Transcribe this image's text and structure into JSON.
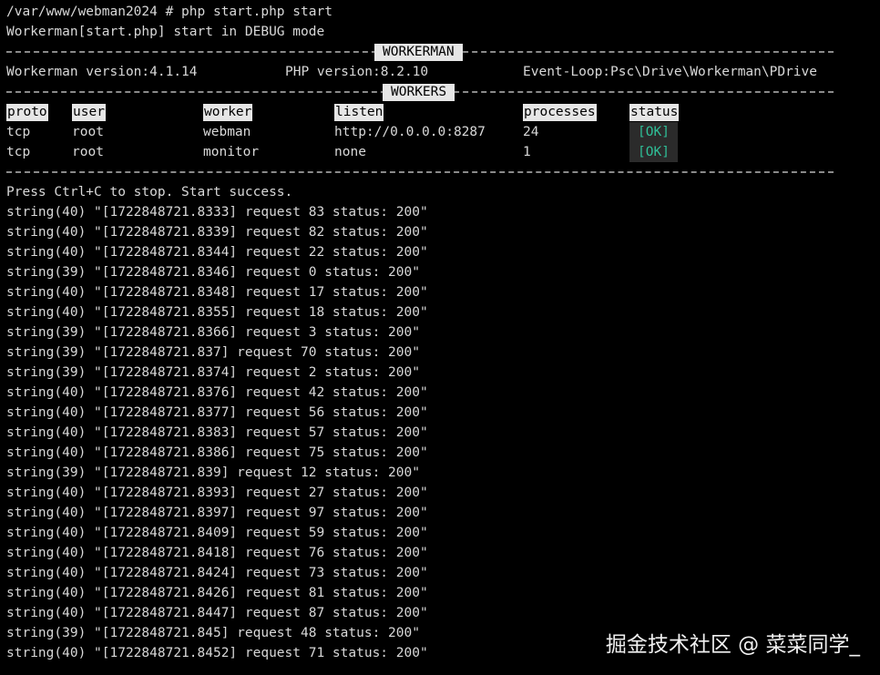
{
  "terminal": {
    "prompt_command": "/var/www/webman2024 # php start.php start",
    "start_mode": "Workerman[start.php] start in DEBUG mode",
    "workerman_label": "WORKERMAN",
    "versions": {
      "workerman": "Workerman version:4.1.14",
      "php": "PHP version:8.2.10",
      "event_loop": "Event-Loop:Psc\\Drive\\Workerman\\PDrive"
    },
    "workers_label": "WORKERS",
    "headers": {
      "proto": "proto",
      "user": "user",
      "worker": "worker",
      "listen": "listen",
      "processes": "processes",
      "status": "status"
    },
    "workers": [
      {
        "proto": "tcp",
        "user": "root",
        "worker": "webman",
        "listen": "http://0.0.0.0:8287",
        "processes": "24",
        "status": "[OK]"
      },
      {
        "proto": "tcp",
        "user": "root",
        "worker": "monitor",
        "listen": "none",
        "processes": "1",
        "status": "[OK]"
      }
    ],
    "start_message": "Press Ctrl+C to stop. Start success.",
    "log_lines": [
      "string(40) \"[1722848721.8333] request 83 status: 200\"",
      "string(40) \"[1722848721.8339] request 82 status: 200\"",
      "string(40) \"[1722848721.8344] request 22 status: 200\"",
      "string(39) \"[1722848721.8346] request 0 status: 200\"",
      "string(40) \"[1722848721.8348] request 17 status: 200\"",
      "string(40) \"[1722848721.8355] request 18 status: 200\"",
      "string(39) \"[1722848721.8366] request 3 status: 200\"",
      "string(39) \"[1722848721.837] request 70 status: 200\"",
      "string(39) \"[1722848721.8374] request 2 status: 200\"",
      "string(40) \"[1722848721.8376] request 42 status: 200\"",
      "string(40) \"[1722848721.8377] request 56 status: 200\"",
      "string(40) \"[1722848721.8383] request 57 status: 200\"",
      "string(40) \"[1722848721.8386] request 75 status: 200\"",
      "string(39) \"[1722848721.839] request 12 status: 200\"",
      "string(40) \"[1722848721.8393] request 27 status: 200\"",
      "string(40) \"[1722848721.8397] request 97 status: 200\"",
      "string(40) \"[1722848721.8409] request 59 status: 200\"",
      "string(40) \"[1722848721.8418] request 76 status: 200\"",
      "string(40) \"[1722848721.8424] request 73 status: 200\"",
      "string(40) \"[1722848721.8426] request 81 status: 200\"",
      "string(40) \"[1722848721.8447] request 87 status: 200\"",
      "string(39) \"[1722848721.845] request 48 status: 200\"",
      "string(40) \"[1722848721.8452] request 71 status: 200\""
    ]
  },
  "watermark": "掘金技术社区 @ 菜菜同学_",
  "colors": {
    "background": "#000000",
    "text": "#d8d8d8",
    "ok": "#2fbf97"
  }
}
